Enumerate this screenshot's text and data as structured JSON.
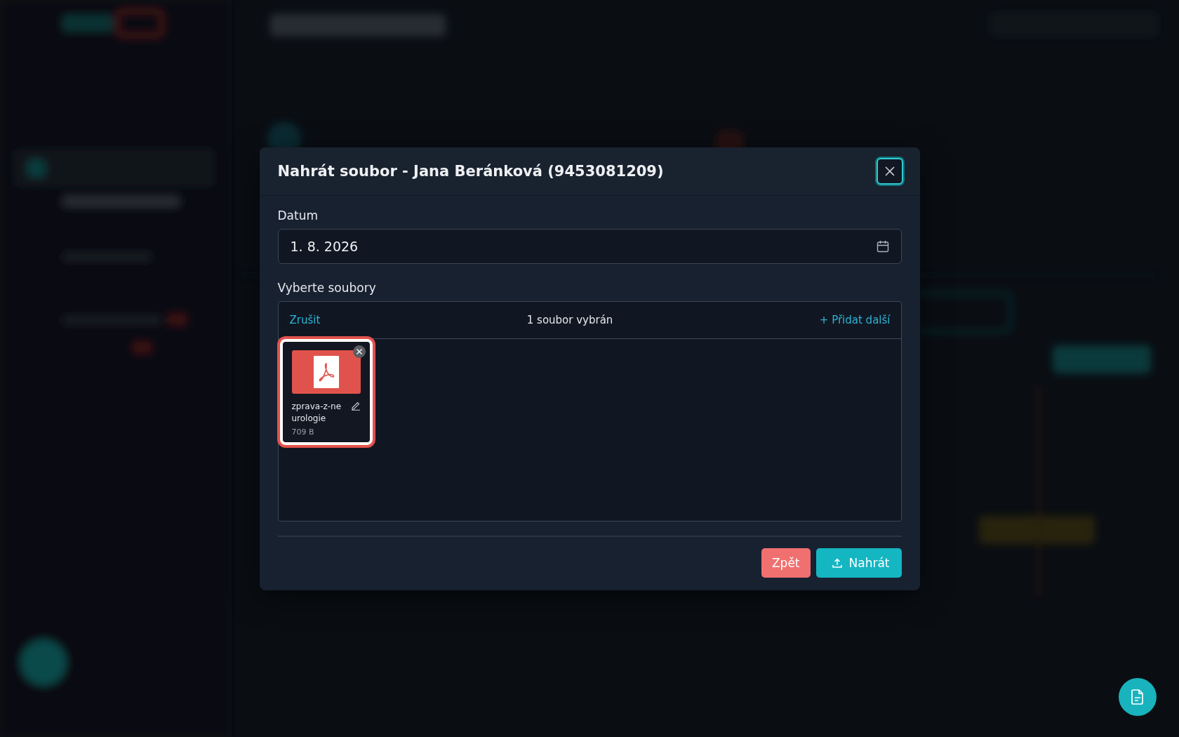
{
  "modal": {
    "title": "Nahrát soubor - Jana Beránková (9453081209)",
    "date": {
      "label": "Datum",
      "value": "1. 8. 2026"
    },
    "files_label": "Vyberte soubory",
    "dropzone": {
      "cancel": "Zrušit",
      "status": "1 soubor vybrán",
      "add_more": "+ Přidat další"
    },
    "files": [
      {
        "kind": "pdf",
        "name": "zprava-z-neurologie",
        "size": "709 B",
        "selected": true
      }
    ],
    "buttons": [
      {
        "kind": "secondary",
        "label": "Zpět"
      },
      {
        "kind": "primary",
        "label": "Nahrát"
      }
    ]
  }
}
